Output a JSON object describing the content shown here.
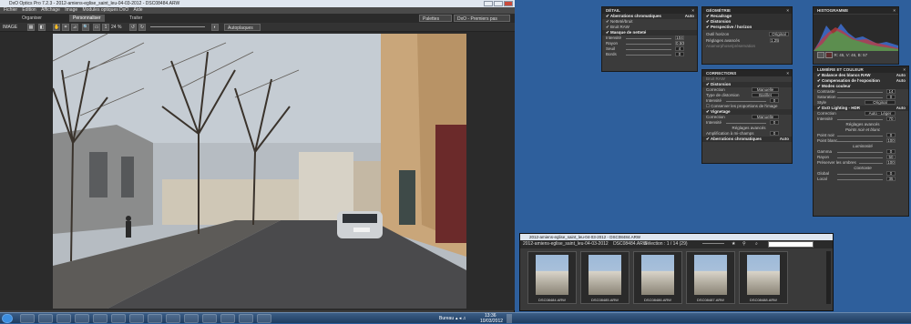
{
  "window": {
    "title": "DxO Optics Pro 7.2.3 - 2012-amiens-eglise_saint_leu-04-03-2012 - DSC08484.ARW",
    "menus": [
      "Fichier",
      "Edition",
      "Affichage",
      "Image",
      "Modules optiques DxO",
      "Aide"
    ],
    "tabs": {
      "organize": "Organiser",
      "customize": "Personnaliser",
      "process": "Traiter"
    },
    "palettes": "Palettes",
    "preset": "DxO - Premiers pas",
    "image_label": "IMAGE",
    "zoom": "24 %",
    "autoplay": "Autoplaques"
  },
  "panels": {
    "detail": {
      "title": "DÉTAIL",
      "rows": [
        {
          "label": "Aberrations chromatiques",
          "value": "Auto"
        },
        {
          "label": "Netteté/bruit",
          "value": ""
        },
        {
          "label": "Bruit RAW",
          "value": ""
        },
        {
          "label": "Masque de netteté",
          "value": ""
        },
        {
          "label": "Intensité",
          "value": "104"
        },
        {
          "label": "Rayon",
          "value": "0.50"
        },
        {
          "label": "Seuil",
          "value": "4"
        },
        {
          "label": "Bords",
          "value": "0"
        }
      ]
    },
    "geometry": {
      "title": "GÉOMÉTRIE",
      "rows": [
        {
          "label": "Recadrage",
          "value": ""
        },
        {
          "label": "Distorsion",
          "value": ""
        },
        {
          "label": "Perspective / horizon",
          "value": ""
        },
        {
          "label": "Outil horizon",
          "value": "Original"
        },
        {
          "label": "Réglages avancés",
          "value": "1.25"
        },
        {
          "label": "Anamorphose/préservation",
          "value": ""
        }
      ]
    },
    "corrections": {
      "title": "CORRECTIONS",
      "rows": [
        {
          "label": "Bruit RAW",
          "value": ""
        },
        {
          "label": "Distorsion",
          "value": ""
        },
        {
          "label": "Correction",
          "value": "Manuelle"
        },
        {
          "label": "Type de distorsion",
          "value": "Barillet"
        },
        {
          "label": "Intensité",
          "value": "0"
        },
        {
          "label": "Conserver les proportions de l'image",
          "value": ""
        },
        {
          "label": "Vignetage",
          "value": ""
        },
        {
          "label": "Correction",
          "value": "Manuelle"
        },
        {
          "label": "Intensité",
          "value": "0"
        },
        {
          "label": "Réglages avancés",
          "value": ""
        },
        {
          "label": "Amplification à mi-champs",
          "value": "0"
        },
        {
          "label": "Aberrations chromatiques",
          "value": "Auto"
        }
      ]
    },
    "histogram": {
      "title": "HISTOGRAMME",
      "readout": "R: 45, V: 46, B: 57"
    },
    "light": {
      "title": "LUMIÈRE ET COULEUR",
      "rows": [
        {
          "label": "Balance des blancs RAW",
          "value": "Auto"
        },
        {
          "label": "Compensation de l'exposition",
          "value": "Auto"
        },
        {
          "label": "Modes couleur",
          "value": ""
        },
        {
          "label": "Contraste",
          "value": "14"
        },
        {
          "label": "Saturation",
          "value": "0"
        },
        {
          "label": "Style",
          "value": "Original"
        },
        {
          "label": "DxO Lighting - HDR",
          "value": "Auto"
        },
        {
          "label": "Correction",
          "value": "Auto - Léger"
        },
        {
          "label": "Intensité",
          "value": "70"
        },
        {
          "label": "Réglages avancés",
          "value": ""
        },
        {
          "label": "Points noir et blanc",
          "value": ""
        },
        {
          "label": "Point noir",
          "value": "0"
        },
        {
          "label": "Point blanc",
          "value": "100"
        },
        {
          "label": "Luminosité",
          "value": ""
        },
        {
          "label": "Gamma",
          "value": "0"
        },
        {
          "label": "Rayon",
          "value": "50"
        },
        {
          "label": "Préserver les ombres",
          "value": "100"
        },
        {
          "label": "Contraste",
          "value": ""
        },
        {
          "label": "Global",
          "value": "0"
        },
        {
          "label": "Local",
          "value": "35"
        }
      ]
    }
  },
  "filmstrip": {
    "title": "2012-amiens-eglise_saint_leu-04-03-2012 - DSC08484.ARW",
    "folder": "2012-amiens-eglise_saint_leu-04-03-2012",
    "file": "DSC08484.ARW",
    "selection": "Sélection : 1 / 14 (29)",
    "thumbnails": [
      "DSC08484.ARW",
      "DSC08485.ARW",
      "DSC08486.ARW",
      "DSC08487.ARW",
      "DSC08488.ARW"
    ]
  },
  "taskbar": {
    "desktop": "Bureau",
    "time": "13:36",
    "date": "10/03/2012"
  }
}
